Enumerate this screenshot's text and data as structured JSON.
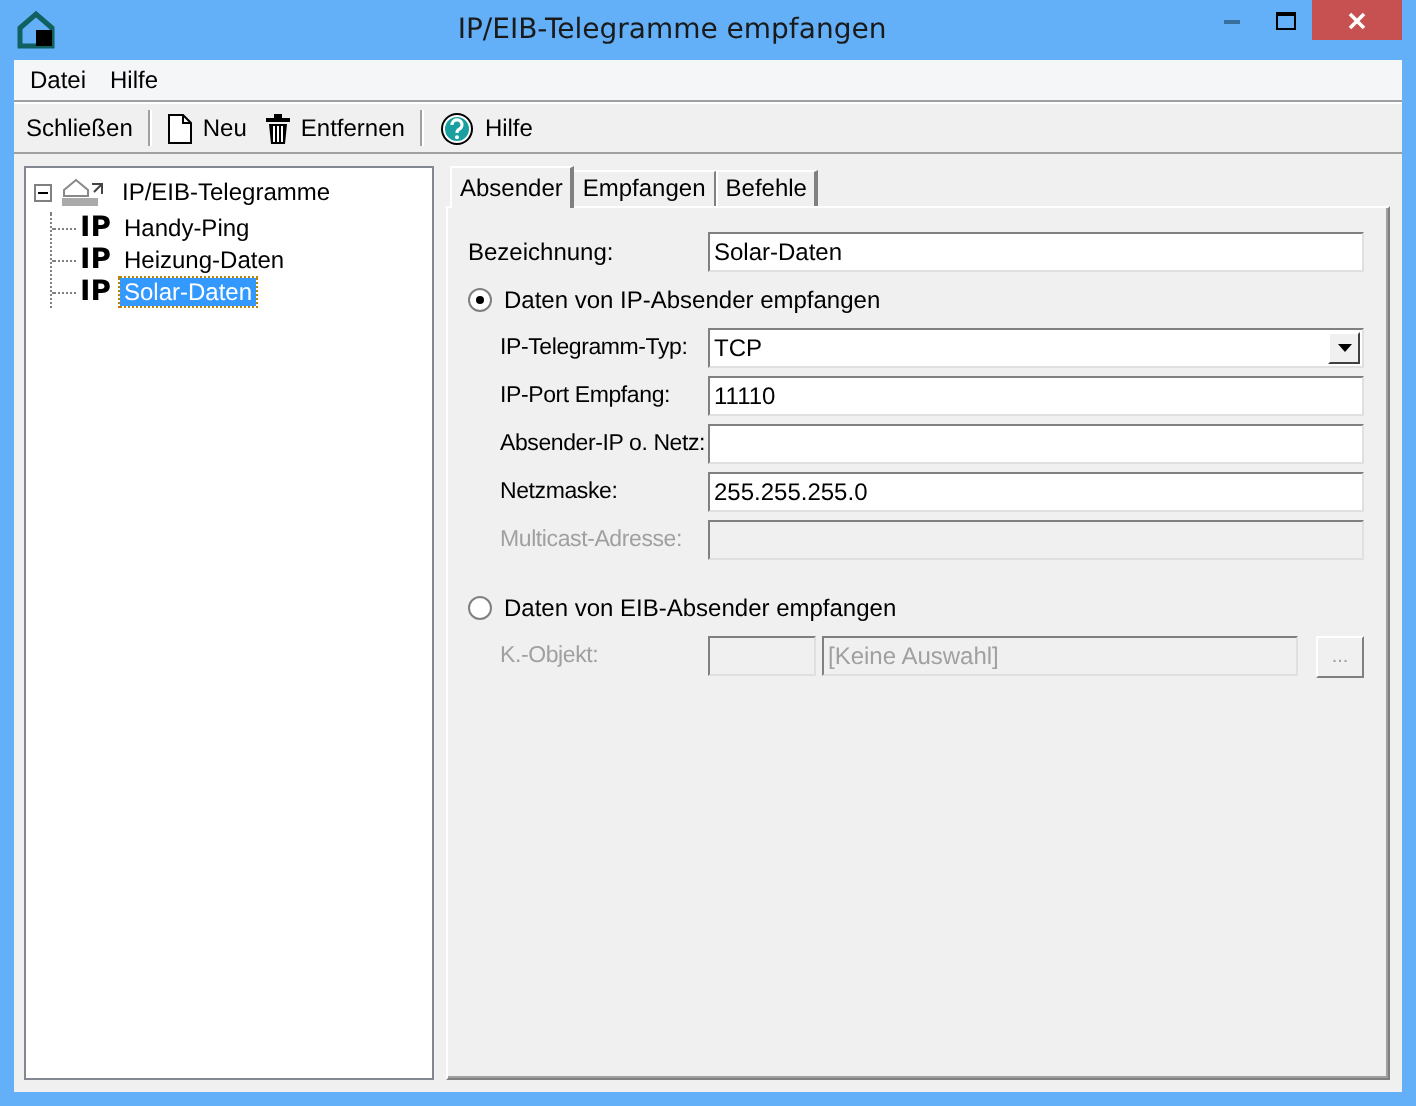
{
  "window": {
    "title": "IP/EIB-Telegramme empfangen"
  },
  "menu": [
    {
      "label": "Datei"
    },
    {
      "label": "Hilfe"
    }
  ],
  "toolbar": [
    [
      {
        "label": "Schließen",
        "kind": "text"
      }
    ],
    [
      {
        "label": "Neu",
        "kind": "new"
      },
      {
        "label": "Entfernen",
        "kind": "delete"
      }
    ],
    [
      {
        "label": "Hilfe",
        "kind": "help"
      }
    ]
  ],
  "tree": {
    "label": "IP/EIB-Telegramme",
    "expanded": true,
    "selected": false,
    "children": [
      {
        "badge": "IP",
        "label": "Handy-Ping",
        "selected": false
      },
      {
        "badge": "IP",
        "label": "Heizung-Daten",
        "selected": false
      },
      {
        "badge": "IP",
        "label": "Solar-Daten",
        "selected": true
      }
    ]
  },
  "tabs": [
    {
      "label": "Absender",
      "selected": true
    },
    {
      "label": "Empfangen",
      "selected": false
    },
    {
      "label": "Befehle",
      "selected": false
    }
  ],
  "form": {
    "name_label": "Bezeichnung:",
    "name_value": "Solar-Daten",
    "ip_option": {
      "label": "Daten von IP-Absender empfangen",
      "selected": true
    },
    "ip_fields": [
      {
        "kind": "dropdown",
        "label": "IP-Telegramm-Typ:",
        "value": "TCP",
        "disabled": false
      },
      {
        "kind": "text",
        "label": "IP-Port Empfang:",
        "value": "11110",
        "disabled": false
      },
      {
        "kind": "text",
        "label": "Absender-IP o. Netz:",
        "disabled": false
      },
      {
        "kind": "text",
        "label": "Netzmaske:",
        "value": "255.255.255.0",
        "disabled": false
      },
      {
        "kind": "text",
        "label": "Multicast-Adresse:",
        "disabled": true
      }
    ],
    "eib_option": {
      "label": "Daten von EIB-Absender empfangen",
      "selected": false
    },
    "eib_object": {
      "label": "K.-Objekt:",
      "value": "[Keine Auswahl]",
      "button": "...",
      "disabled": true
    }
  }
}
